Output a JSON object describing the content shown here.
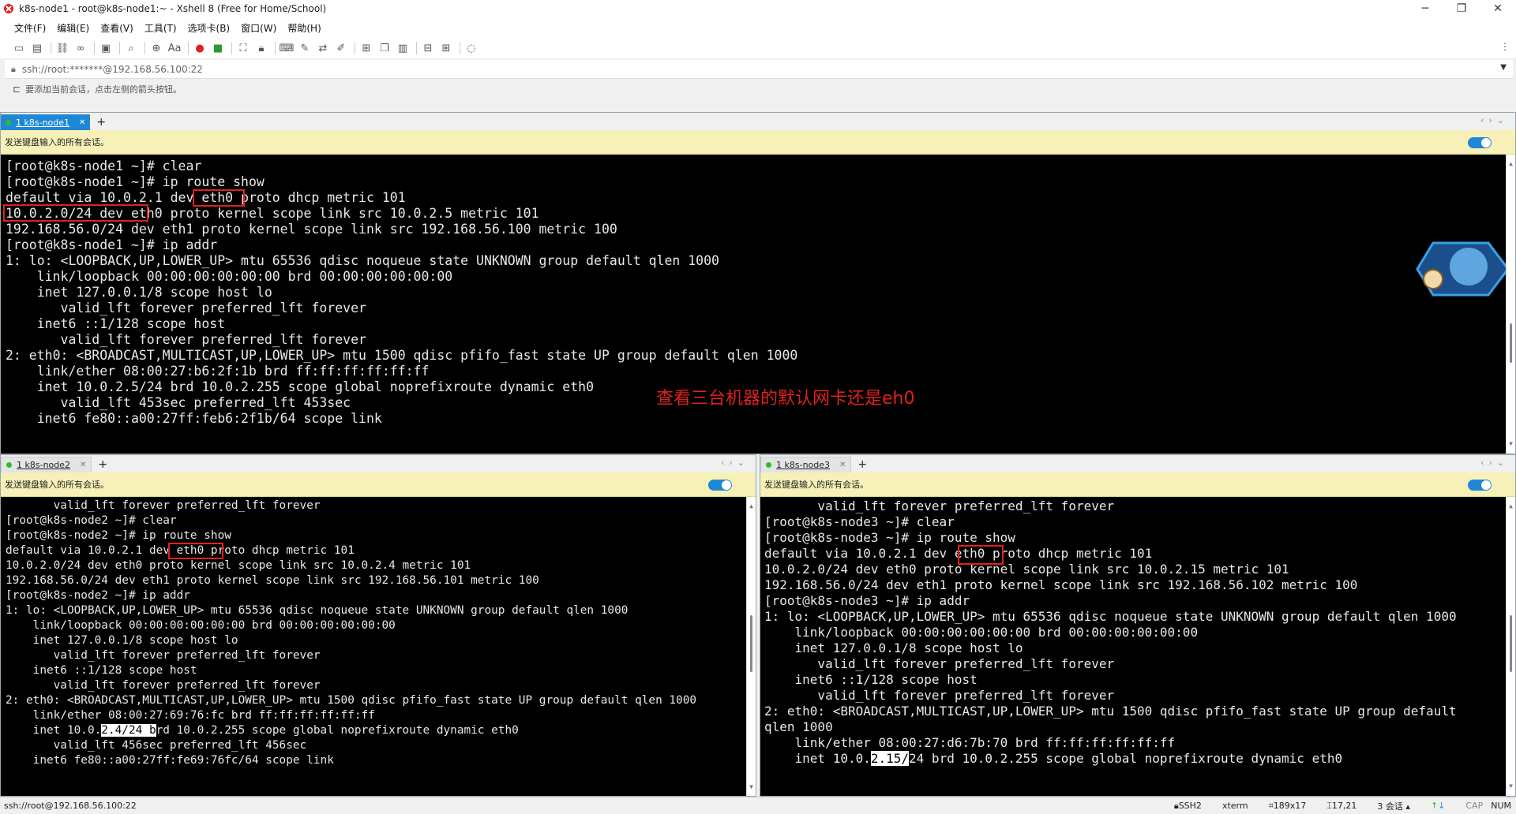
{
  "window": {
    "title": "k8s-node1 - root@k8s-node1:~ - Xshell 8 (Free for Home/School)",
    "minimize": "─",
    "maximize": "❐",
    "close": "✕"
  },
  "menu": [
    "文件(F)",
    "编辑(E)",
    "查看(V)",
    "工具(T)",
    "选项卡(B)",
    "窗口(W)",
    "帮助(H)"
  ],
  "address": {
    "value": "ssh://root:*******@192.168.56.100:22"
  },
  "hint": "要添加当前会话，点击左侧的箭头按钮。",
  "broadcast_label": "发送键盘输入的所有会话。",
  "colors": {
    "tab_active": "#1e88d6",
    "broadcast_bg": "#f7f1b7",
    "highlight": "#e02020",
    "status_dot": "#27c227"
  },
  "panes": {
    "node1": {
      "tab_label": "1 k8s-node1",
      "lines": [
        "[root@k8s-node1 ~]# clear",
        "[root@k8s-node1 ~]# ip route show",
        "default via 10.0.2.1 dev eth0 proto dhcp metric 101",
        "10.0.2.0/24 dev eth0 proto kernel scope link src 10.0.2.5 metric 101",
        "192.168.56.0/24 dev eth1 proto kernel scope link src 192.168.56.100 metric 100",
        "[root@k8s-node1 ~]# ip addr",
        "1: lo: <LOOPBACK,UP,LOWER_UP> mtu 65536 qdisc noqueue state UNKNOWN group default qlen 1000",
        "    link/loopback 00:00:00:00:00:00 brd 00:00:00:00:00:00",
        "    inet 127.0.0.1/8 scope host lo",
        "       valid_lft forever preferred_lft forever",
        "    inet6 ::1/128 scope host",
        "       valid_lft forever preferred_lft forever",
        "2: eth0: <BROADCAST,MULTICAST,UP,LOWER_UP> mtu 1500 qdisc pfifo_fast state UP group default qlen 1000",
        "    link/ether 08:00:27:b6:2f:1b brd ff:ff:ff:ff:ff:ff",
        "    inet 10.0.2.5/24 brd 10.0.2.255 scope global noprefixroute dynamic eth0",
        "       valid_lft 453sec preferred_lft 453sec",
        "    inet6 fe80::a00:27ff:feb6:2f1b/64 scope link"
      ],
      "annotation": "查看三台机器的默认网卡还是eh0"
    },
    "node2": {
      "tab_label": "1 k8s-node2",
      "lines": [
        "       valid_lft forever preferred_lft forever",
        "[root@k8s-node2 ~]# clear",
        "[root@k8s-node2 ~]# ip route show",
        "default via 10.0.2.1 dev eth0 proto dhcp metric 101",
        "10.0.2.0/24 dev eth0 proto kernel scope link src 10.0.2.4 metric 101",
        "192.168.56.0/24 dev eth1 proto kernel scope link src 192.168.56.101 metric 100",
        "[root@k8s-node2 ~]# ip addr",
        "1: lo: <LOOPBACK,UP,LOWER_UP> mtu 65536 qdisc noqueue state UNKNOWN group default qlen 1000",
        "    link/loopback 00:00:00:00:00:00 brd 00:00:00:00:00:00",
        "    inet 127.0.0.1/8 scope host lo",
        "       valid_lft forever preferred_lft forever",
        "    inet6 ::1/128 scope host",
        "       valid_lft forever preferred_lft forever",
        "2: eth0: <BROADCAST,MULTICAST,UP,LOWER_UP> mtu 1500 qdisc pfifo_fast state UP group default qlen 1000",
        "    link/ether 08:00:27:69:76:fc brd ff:ff:ff:ff:ff:ff",
        "    inet 10.0.2.4/24 brd 10.0.2.255 scope global noprefixroute dynamic eth0",
        "       valid_lft 456sec preferred_lft 456sec",
        "    inet6 fe80::a00:27ff:fe69:76fc/64 scope link"
      ]
    },
    "node3": {
      "tab_label": "1 k8s-node3",
      "lines": [
        "       valid_lft forever preferred_lft forever",
        "[root@k8s-node3 ~]# clear",
        "[root@k8s-node3 ~]# ip route show",
        "default via 10.0.2.1 dev eth0 proto dhcp metric 101",
        "10.0.2.0/24 dev eth0 proto kernel scope link src 10.0.2.15 metric 101",
        "192.168.56.0/24 dev eth1 proto kernel scope link src 192.168.56.102 metric 100",
        "[root@k8s-node3 ~]# ip addr",
        "1: lo: <LOOPBACK,UP,LOWER_UP> mtu 65536 qdisc noqueue state UNKNOWN group default qlen 1000",
        "    link/loopback 00:00:00:00:00:00 brd 00:00:00:00:00:00",
        "    inet 127.0.0.1/8 scope host lo",
        "       valid_lft forever preferred_lft forever",
        "    inet6 ::1/128 scope host",
        "       valid_lft forever preferred_lft forever",
        "2: eth0: <BROADCAST,MULTICAST,UP,LOWER_UP> mtu 1500 qdisc pfifo_fast state UP group default",
        "qlen 1000",
        "    link/ether 08:00:27:d6:7b:70 brd ff:ff:ff:ff:ff:ff",
        "    inet 10.0.2.15/24 brd 10.0.2.255 scope global noprefixroute dynamic eth0"
      ]
    }
  },
  "status": {
    "connection": "ssh://root@192.168.56.100:22",
    "protocol": "SSH2",
    "terminal": "xterm",
    "size": "189x17",
    "cursor": "17,21",
    "sessions": "3 会话",
    "cap": "CAP",
    "num": "NUM"
  }
}
